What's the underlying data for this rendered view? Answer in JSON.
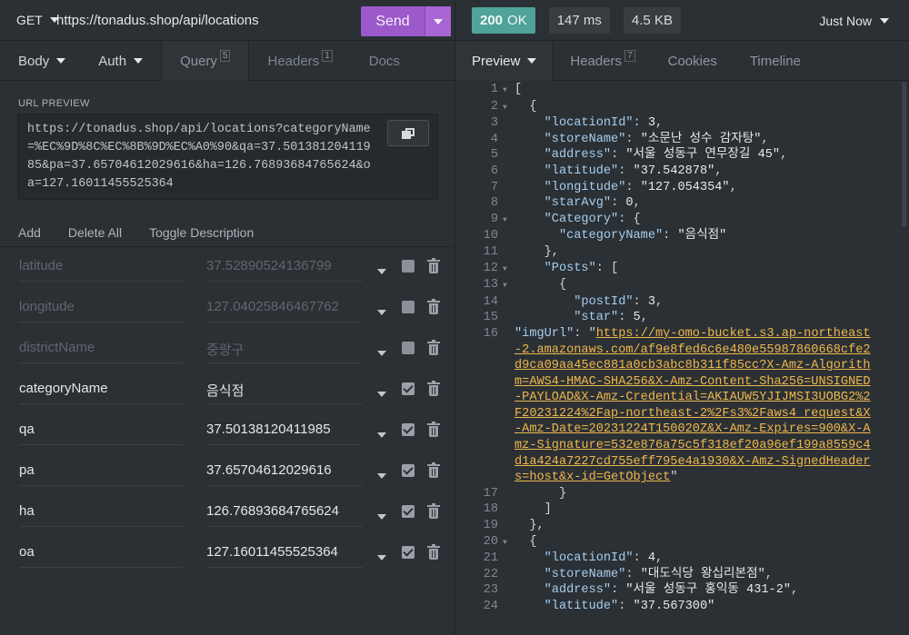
{
  "request": {
    "method": "GET",
    "url": "https://tonadus.shop/api/locations",
    "send_label": "Send"
  },
  "request_tabs": [
    {
      "label": "Body",
      "badge": ""
    },
    {
      "label": "Auth",
      "badge": ""
    },
    {
      "label": "Query",
      "badge": "5"
    },
    {
      "label": "Headers",
      "badge": "1"
    },
    {
      "label": "Docs",
      "badge": ""
    }
  ],
  "url_preview": {
    "label": "URL PREVIEW",
    "text": "https://tonadus.shop/api/locations?categoryName=%EC%9D%8C%EC%8B%9D%EC%A0%90&qa=37.50138120411985&pa=37.65704612029616&ha=126.76893684765624&oa=127.16011455525364"
  },
  "param_actions": {
    "add": "Add",
    "delete_all": "Delete All",
    "toggle_description": "Toggle Description"
  },
  "params": [
    {
      "name": "latitude",
      "value": "37.52890524136799",
      "enabled": false
    },
    {
      "name": "longitude",
      "value": "127.04025846467762",
      "enabled": false
    },
    {
      "name": "districtName",
      "value": "중랑구",
      "enabled": false
    },
    {
      "name": "categoryName",
      "value": "음식점",
      "enabled": true
    },
    {
      "name": "qa",
      "value": "37.50138120411985",
      "enabled": true
    },
    {
      "name": "pa",
      "value": "37.65704612029616",
      "enabled": true
    },
    {
      "name": "ha",
      "value": "126.76893684765624",
      "enabled": true
    },
    {
      "name": "oa",
      "value": "127.16011455525364",
      "enabled": true
    }
  ],
  "response": {
    "status": "200 OK",
    "status_code": "200",
    "status_text": "OK",
    "time": "147 ms",
    "size": "4.5 KB",
    "when": "Just Now"
  },
  "response_tabs": [
    {
      "label": "Preview",
      "badge": ""
    },
    {
      "label": "Headers",
      "badge": "7"
    },
    {
      "label": "Cookies",
      "badge": ""
    },
    {
      "label": "Timeline",
      "badge": ""
    }
  ],
  "body_lines": [
    {
      "n": "1",
      "fold": true,
      "segs": [
        [
          "p",
          "["
        ]
      ]
    },
    {
      "n": "2",
      "fold": true,
      "segs": [
        [
          "p",
          "  {"
        ]
      ]
    },
    {
      "n": "3",
      "fold": false,
      "segs": [
        [
          "p",
          "    "
        ],
        [
          "k",
          "\"locationId\""
        ],
        [
          "p",
          ": "
        ],
        [
          "n",
          "3"
        ],
        [
          "p",
          ","
        ]
      ]
    },
    {
      "n": "4",
      "fold": false,
      "segs": [
        [
          "p",
          "    "
        ],
        [
          "k",
          "\"storeName\""
        ],
        [
          "p",
          ": "
        ],
        [
          "s",
          "\"소문난 성수 감자탕\""
        ],
        [
          "p",
          ","
        ]
      ]
    },
    {
      "n": "5",
      "fold": false,
      "segs": [
        [
          "p",
          "    "
        ],
        [
          "k",
          "\"address\""
        ],
        [
          "p",
          ": "
        ],
        [
          "s",
          "\"서울 성동구 연무장길 45\""
        ],
        [
          "p",
          ","
        ]
      ]
    },
    {
      "n": "6",
      "fold": false,
      "segs": [
        [
          "p",
          "    "
        ],
        [
          "k",
          "\"latitude\""
        ],
        [
          "p",
          ": "
        ],
        [
          "s",
          "\"37.542878\""
        ],
        [
          "p",
          ","
        ]
      ]
    },
    {
      "n": "7",
      "fold": false,
      "segs": [
        [
          "p",
          "    "
        ],
        [
          "k",
          "\"longitude\""
        ],
        [
          "p",
          ": "
        ],
        [
          "s",
          "\"127.054354\""
        ],
        [
          "p",
          ","
        ]
      ]
    },
    {
      "n": "8",
      "fold": false,
      "segs": [
        [
          "p",
          "    "
        ],
        [
          "k",
          "\"starAvg\""
        ],
        [
          "p",
          ": "
        ],
        [
          "n",
          "0"
        ],
        [
          "p",
          ","
        ]
      ]
    },
    {
      "n": "9",
      "fold": true,
      "segs": [
        [
          "p",
          "    "
        ],
        [
          "k",
          "\"Category\""
        ],
        [
          "p",
          ": {"
        ]
      ]
    },
    {
      "n": "10",
      "fold": false,
      "segs": [
        [
          "p",
          "      "
        ],
        [
          "k",
          "\"categoryName\""
        ],
        [
          "p",
          ": "
        ],
        [
          "s",
          "\"음식점\""
        ]
      ]
    },
    {
      "n": "11",
      "fold": false,
      "segs": [
        [
          "p",
          "    },"
        ]
      ]
    },
    {
      "n": "12",
      "fold": true,
      "segs": [
        [
          "p",
          "    "
        ],
        [
          "k",
          "\"Posts\""
        ],
        [
          "p",
          ": ["
        ]
      ]
    },
    {
      "n": "13",
      "fold": true,
      "segs": [
        [
          "p",
          "      {"
        ]
      ]
    },
    {
      "n": "14",
      "fold": false,
      "segs": [
        [
          "p",
          "        "
        ],
        [
          "k",
          "\"postId\""
        ],
        [
          "p",
          ": "
        ],
        [
          "n",
          "3"
        ],
        [
          "p",
          ","
        ]
      ]
    },
    {
      "n": "15",
      "fold": false,
      "segs": [
        [
          "p",
          "        "
        ],
        [
          "k",
          "\"star\""
        ],
        [
          "p",
          ": "
        ],
        [
          "n",
          "5"
        ],
        [
          "p",
          ","
        ]
      ]
    },
    {
      "n": "16",
      "fold": false,
      "wrap": true,
      "segs": [
        [
          "p",
          "        "
        ],
        [
          "k",
          "\"imgUrl\""
        ],
        [
          "p",
          ": \""
        ],
        [
          "link",
          "https://my-omo-bucket.s3.ap-northeast-2.amazonaws.com/af9e8fed6c6e480e55987860668cfe2d9ca09aa45ec881a0cb3abc8b311f85cc?X-Amz-Algorithm=AWS4-HMAC-SHA256&X-Amz-Content-Sha256=UNSIGNED-PAYLOAD&X-Amz-Credential=AKIAUW5YJIJMSI3UOBG2%2F20231224%2Fap-northeast-2%2Fs3%2Faws4_request&X-Amz-Date=20231224T150020Z&X-Amz-Expires=900&X-Amz-Signature=532e876a75c5f318ef20a96ef199a8559c4d1a424a7227cd755eff795e4a1930&X-Amz-SignedHeaders=host&x-id=GetObject"
        ],
        [
          "p",
          "\""
        ]
      ]
    },
    {
      "n": "17",
      "fold": false,
      "segs": [
        [
          "p",
          "      }"
        ]
      ]
    },
    {
      "n": "18",
      "fold": false,
      "segs": [
        [
          "p",
          "    ]"
        ]
      ]
    },
    {
      "n": "19",
      "fold": false,
      "segs": [
        [
          "p",
          "  },"
        ]
      ]
    },
    {
      "n": "20",
      "fold": true,
      "segs": [
        [
          "p",
          "  {"
        ]
      ]
    },
    {
      "n": "21",
      "fold": false,
      "segs": [
        [
          "p",
          "    "
        ],
        [
          "k",
          "\"locationId\""
        ],
        [
          "p",
          ": "
        ],
        [
          "n",
          "4"
        ],
        [
          "p",
          ","
        ]
      ]
    },
    {
      "n": "22",
      "fold": false,
      "segs": [
        [
          "p",
          "    "
        ],
        [
          "k",
          "\"storeName\""
        ],
        [
          "p",
          ": "
        ],
        [
          "s",
          "\"대도식당 왕십리본점\""
        ],
        [
          "p",
          ","
        ]
      ]
    },
    {
      "n": "23",
      "fold": false,
      "segs": [
        [
          "p",
          "    "
        ],
        [
          "k",
          "\"address\""
        ],
        [
          "p",
          ": "
        ],
        [
          "s",
          "\"서울 성동구 홍익동 431-2\""
        ],
        [
          "p",
          ","
        ]
      ]
    },
    {
      "n": "24",
      "fold": false,
      "segs": [
        [
          "p",
          "    "
        ],
        [
          "k",
          "\"latitude\""
        ],
        [
          "p",
          ": "
        ],
        [
          "s",
          "\"37.567300\""
        ]
      ]
    }
  ],
  "colors": {
    "send_button": "#9b59c9",
    "status_ok": "#4fa39a",
    "json_key": "#a6ceee",
    "json_link": "#f0b74a"
  },
  "icons": [
    "chevron-down-icon",
    "copy-icon",
    "checkbox-icon",
    "trash-icon",
    "fold-arrow-icon"
  ]
}
